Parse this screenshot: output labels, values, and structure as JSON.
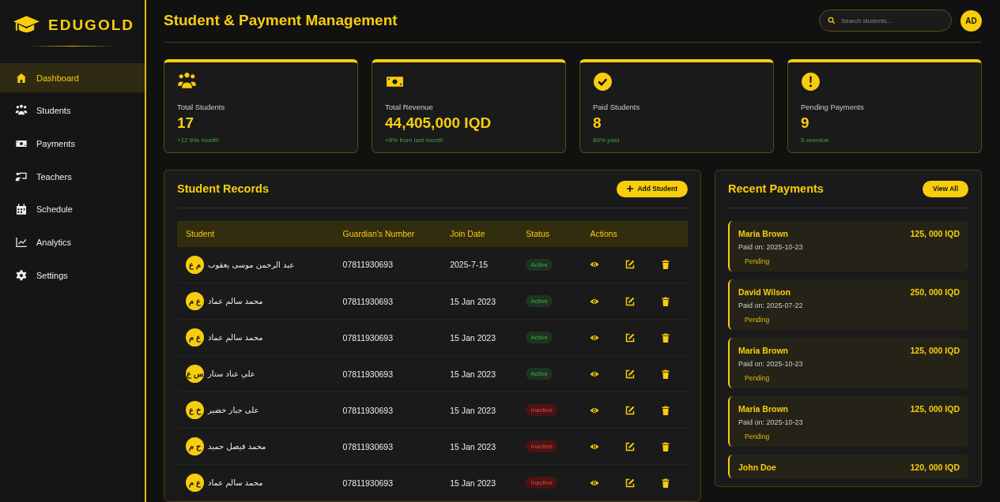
{
  "brand": {
    "name": "EDUGOLD"
  },
  "nav": [
    {
      "label": "Dashboard",
      "kind": "home",
      "selected": true
    },
    {
      "label": "Students",
      "kind": "users",
      "selected": false
    },
    {
      "label": "Payments",
      "kind": "money",
      "selected": false
    },
    {
      "label": "Teachers",
      "kind": "board",
      "selected": false
    },
    {
      "label": "Schedule",
      "kind": "calendar",
      "selected": false
    },
    {
      "label": "Analytics",
      "kind": "chart",
      "selected": false
    },
    {
      "label": "Settings",
      "kind": "gear",
      "selected": false
    }
  ],
  "header": {
    "title": "Student & Payment Management",
    "search_placeholder": "Search students...",
    "avatar": "AD"
  },
  "stats": [
    {
      "kind": "users",
      "label": "Total Students",
      "value": "17",
      "note": "+12 this month"
    },
    {
      "kind": "money",
      "label": "Total Revenue",
      "value": "44,405,000 IQD",
      "note": "+8% from last month"
    },
    {
      "kind": "check",
      "label": "Paid Students",
      "value": "8",
      "note": "80% paid"
    },
    {
      "kind": "alert",
      "label": "Pending Payments",
      "value": "9",
      "note": "5 overdue"
    }
  ],
  "records": {
    "title": "Student Records",
    "add_button": "Add Student",
    "columns": [
      "Student",
      "Guardian's Number",
      "Join Date",
      "Status",
      "Actions"
    ],
    "rows": [
      {
        "initials": "م ع",
        "name": "عبد الرحمن موسى يعقوب",
        "phone": "07811930693",
        "joined": "2025-7-15",
        "status": "Active",
        "kind": "active"
      },
      {
        "initials": "ع م",
        "name": "محمد سالم عماد",
        "phone": "07811930693",
        "joined": "15 Jan 2023",
        "status": "Active",
        "kind": "active"
      },
      {
        "initials": "ع م",
        "name": "محمد سالم عماد",
        "phone": "07811930693",
        "joined": "15 Jan 2023",
        "status": "Active",
        "kind": "active"
      },
      {
        "initials": "س ع",
        "name": "علي عناد ستار",
        "phone": "07811930693",
        "joined": "15 Jan 2023",
        "status": "Active",
        "kind": "active"
      },
      {
        "initials": "خ ع",
        "name": "على جبار خضير",
        "phone": "07811930693",
        "joined": "15 Jan 2023",
        "status": "Inactive",
        "kind": "inactive"
      },
      {
        "initials": "ح م",
        "name": "محمد فيصل حميد",
        "phone": "07811930693",
        "joined": "15 Jan 2023",
        "status": "Inactive",
        "kind": "inactive"
      },
      {
        "initials": "ع م",
        "name": "محمد سالم عماد",
        "phone": "07811930693",
        "joined": "15 Jan 2023",
        "status": "Inactive",
        "kind": "inactive"
      }
    ]
  },
  "payments": {
    "title": "Recent Payments",
    "view_all": "View All",
    "items": [
      {
        "name": "Maria Brown",
        "amount": "125, 000 IQD",
        "date": "Paid on: 2025-10-23",
        "status": "Pending"
      },
      {
        "name": "David Wilson",
        "amount": "250, 000 IQD",
        "date": "Paid on: 2025-07-22",
        "status": "Pending"
      },
      {
        "name": "Maria Brown",
        "amount": "125, 000 IQD",
        "date": "Paid on: 2025-10-23",
        "status": "Pending"
      },
      {
        "name": "Maria Brown",
        "amount": "125, 000 IQD",
        "date": "Paid on: 2025-10-23",
        "status": "Pending"
      },
      {
        "name": "John Doe",
        "amount": "120, 000 IQD"
      }
    ]
  }
}
